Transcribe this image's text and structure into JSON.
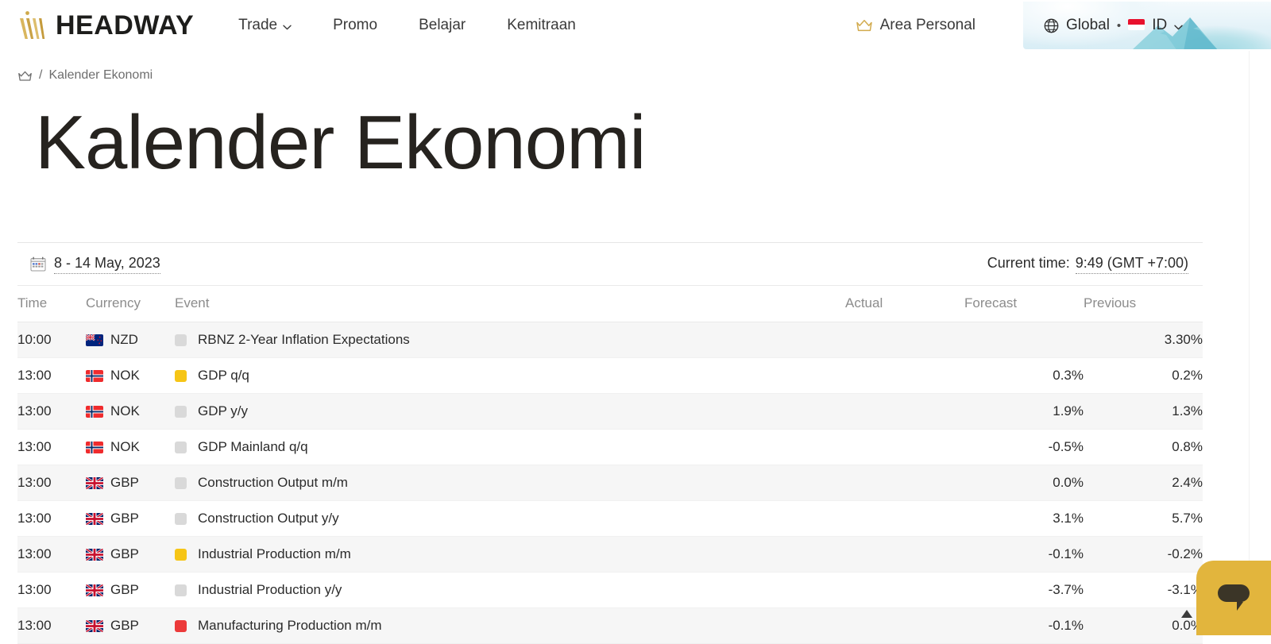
{
  "nav": {
    "logo_text": "HEADWAY",
    "logo_icon": "headway-crown-logo",
    "links": [
      {
        "label": "Trade",
        "icon": "chevron-down-icon",
        "has_chevron": true
      },
      {
        "label": "Promo",
        "has_chevron": false
      },
      {
        "label": "Belajar",
        "has_chevron": false
      },
      {
        "label": "Kemitraan",
        "has_chevron": false
      }
    ],
    "area_personal": {
      "label": "Area Personal",
      "icon": "crown-icon"
    },
    "language": {
      "region_label": "Global",
      "separator": "•",
      "locale_label": "ID",
      "globe_icon": "globe-icon",
      "flag_icon": "flag-indonesia-icon",
      "chevron_icon": "chevron-down-icon"
    }
  },
  "breadcrumb": {
    "home_icon": "crown-icon",
    "separator": "/",
    "current": "Kalender Ekonomi"
  },
  "page": {
    "title": "Kalender Ekonomi"
  },
  "panel": {
    "date_icon": "calendar-icon",
    "date_range": "8 - 14 May, 2023",
    "current_time_label": "Current time:",
    "current_time_value": "9:49 (GMT +7:00)",
    "scroll_up_icon": "chevron-up-icon"
  },
  "table": {
    "headers": {
      "time": "Time",
      "currency": "Currency",
      "event": "Event",
      "actual": "Actual",
      "forecast": "Forecast",
      "previous": "Previous"
    },
    "rows": [
      {
        "time": "10:00",
        "currency": "NZD",
        "flag": "flag-new-zealand-icon",
        "impact": "low",
        "event": "RBNZ 2-Year Inflation Expectations",
        "actual": "",
        "forecast": "",
        "previous": "3.30%"
      },
      {
        "time": "13:00",
        "currency": "NOK",
        "flag": "flag-norway-icon",
        "impact": "medium",
        "event": "GDP q/q",
        "actual": "",
        "forecast": "0.3%",
        "previous": "0.2%"
      },
      {
        "time": "13:00",
        "currency": "NOK",
        "flag": "flag-norway-icon",
        "impact": "low",
        "event": "GDP y/y",
        "actual": "",
        "forecast": "1.9%",
        "previous": "1.3%"
      },
      {
        "time": "13:00",
        "currency": "NOK",
        "flag": "flag-norway-icon",
        "impact": "low",
        "event": "GDP Mainland q/q",
        "actual": "",
        "forecast": "-0.5%",
        "previous": "0.8%"
      },
      {
        "time": "13:00",
        "currency": "GBP",
        "flag": "flag-uk-icon",
        "impact": "low",
        "event": "Construction Output m/m",
        "actual": "",
        "forecast": "0.0%",
        "previous": "2.4%"
      },
      {
        "time": "13:00",
        "currency": "GBP",
        "flag": "flag-uk-icon",
        "impact": "low",
        "event": "Construction Output y/y",
        "actual": "",
        "forecast": "3.1%",
        "previous": "5.7%"
      },
      {
        "time": "13:00",
        "currency": "GBP",
        "flag": "flag-uk-icon",
        "impact": "medium",
        "event": "Industrial Production m/m",
        "actual": "",
        "forecast": "-0.1%",
        "previous": "-0.2%"
      },
      {
        "time": "13:00",
        "currency": "GBP",
        "flag": "flag-uk-icon",
        "impact": "low",
        "event": "Industrial Production y/y",
        "actual": "",
        "forecast": "-3.7%",
        "previous": "-3.1%"
      },
      {
        "time": "13:00",
        "currency": "GBP",
        "flag": "flag-uk-icon",
        "impact": "high",
        "event": "Manufacturing Production m/m",
        "actual": "",
        "forecast": "-0.1%",
        "previous": "0.0%"
      }
    ]
  },
  "chat": {
    "icon": "chat-bubble-icon"
  },
  "colors": {
    "brand_gold": "#d8b15a",
    "chat_gold": "#e2b53d",
    "impact_low": "#d9d9d9",
    "impact_medium": "#f6c516",
    "impact_high": "#ec3a3a",
    "text_dark": "#262626",
    "text_muted": "#8c8c8c",
    "row_alt": "#f6f6f6"
  }
}
